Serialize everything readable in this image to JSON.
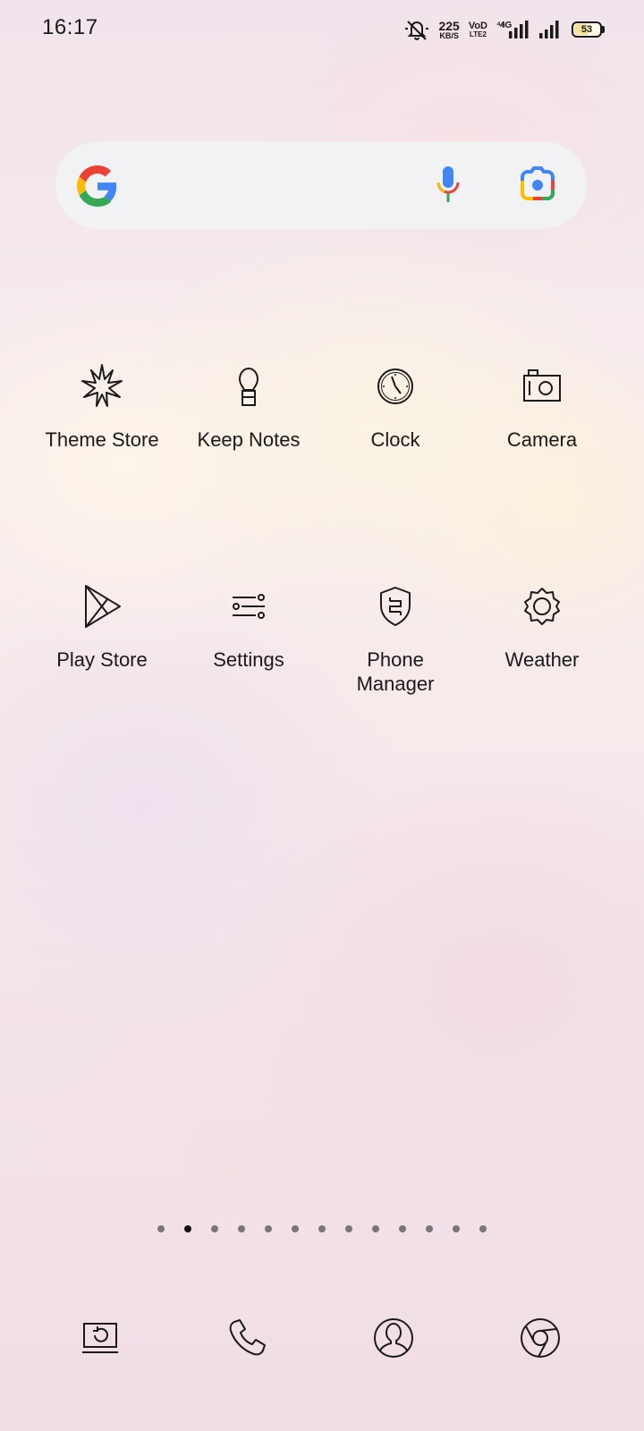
{
  "status_bar": {
    "time": "16:17",
    "net_speed_value": "225",
    "net_speed_unit": "KB/S",
    "volte_top": "VoD",
    "volte_bottom": "LTE2",
    "network_type": "4G",
    "battery_level": "53",
    "icons": [
      "mute-bell-icon",
      "signal-4g-icon",
      "signal-icon",
      "battery-icon"
    ]
  },
  "search": {
    "icons": [
      "google-logo-icon",
      "microphone-icon",
      "lens-camera-icon"
    ],
    "colors": {
      "blue": "#4285F4",
      "red": "#EA4335",
      "yellow": "#FBBC05",
      "green": "#34A853"
    }
  },
  "apps": [
    {
      "label": "Theme Store",
      "icon": "star-burst-icon"
    },
    {
      "label": "Keep Notes",
      "icon": "lightbulb-icon"
    },
    {
      "label": "Clock",
      "icon": "clock-icon"
    },
    {
      "label": "Camera",
      "icon": "camera-icon"
    },
    {
      "label": "Play Store",
      "icon": "play-store-icon"
    },
    {
      "label": "Settings",
      "icon": "settings-sliders-icon"
    },
    {
      "label": "Phone\nManager",
      "label_line1": "Phone",
      "label_line2": "Manager",
      "icon": "shield-icon"
    },
    {
      "label": "Weather",
      "icon": "sun-gear-icon"
    }
  ],
  "page_indicator": {
    "count": 13,
    "active_index": 1
  },
  "dock": [
    {
      "icon": "screen-recorder-icon"
    },
    {
      "icon": "phone-icon"
    },
    {
      "icon": "contacts-icon"
    },
    {
      "icon": "chrome-icon"
    }
  ]
}
